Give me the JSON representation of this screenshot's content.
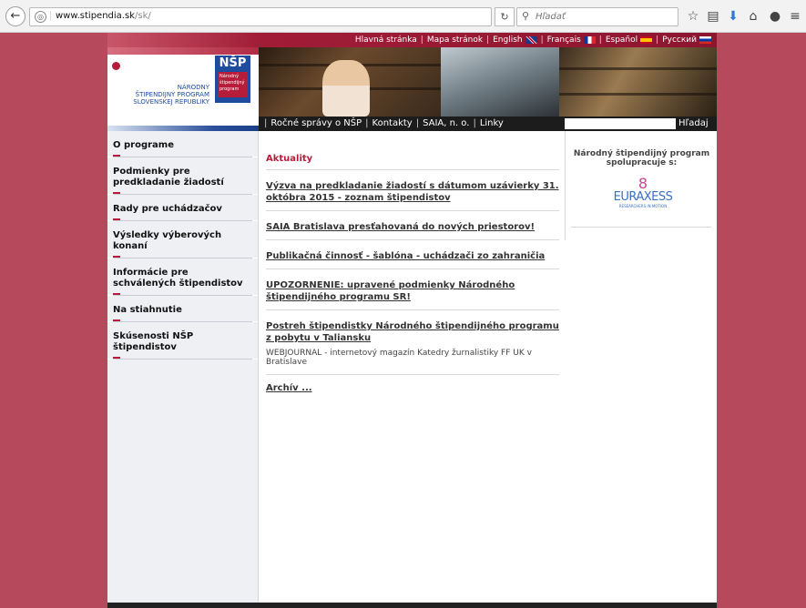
{
  "browser": {
    "url_domain": "www.stipendia.sk",
    "url_path": "/sk/",
    "search_placeholder": "Hľadať"
  },
  "topnav": {
    "items": [
      "Hlavná stránka",
      "Mapa stránok",
      "English",
      "Français",
      "Español",
      "Русский"
    ]
  },
  "logo": {
    "abbr": "NŠP",
    "tag": "Národný štipendijný program",
    "line1": "NÁRODNÝ",
    "line2": "ŠTIPENDIJNÝ PROGRAM",
    "line3": "SLOVENSKEJ REPUBLIKY"
  },
  "subnav": {
    "items": [
      "Ročné správy o NŠP",
      "Kontakty",
      "SAIA, n. o.",
      "Linky"
    ],
    "search_button": "Hľadaj"
  },
  "sidebar": {
    "items": [
      "O programe",
      "Podmienky pre predkladanie žiadostí",
      "Rady pre uchádzačov",
      "Výsledky výberových konaní",
      "Informácie pre schválených štipendistov",
      "Na stiahnutie",
      "Skúsenosti NŠP štipendistov"
    ]
  },
  "main": {
    "title": "Aktuality",
    "news": [
      {
        "title": "Výzva na predkladanie žiadostí s dátumom uzávierky 31. októbra 2015 - zoznam štipendistov",
        "desc": ""
      },
      {
        "title": "SAIA Bratislava presťahovaná do nových priestorov!",
        "desc": ""
      },
      {
        "title": "Publikačná činnosť - šablóna - uchádzači zo zahraničia",
        "desc": ""
      },
      {
        "title": "UPOZORNENIE: upravené podmienky Národného štipendijného programu SR!",
        "desc": ""
      },
      {
        "title": "Postreh štipendistky Národného štipendijného programu z pobytu v Taliansku",
        "desc": "WEBJOURNAL - internetový magazín Katedry žurnalistiky FF UK v Bratislave"
      }
    ],
    "archive": "Archív ..."
  },
  "right": {
    "partner_title": "Národný štipendijný program spolupracuje s:",
    "euraxess_word": "EURAXESS",
    "euraxess_sub": "RESEARCHERS IN MOTION"
  },
  "colors": {
    "brand_red": "#b51d3a",
    "brand_blue": "#1f4c9d",
    "page_bg": "#b64a5c"
  },
  "icons": [
    "back-arrow-icon",
    "globe-icon",
    "reload-icon",
    "search-icon",
    "star-icon",
    "reading-list-icon",
    "download-icon",
    "home-icon",
    "chat-icon",
    "menu-icon"
  ]
}
